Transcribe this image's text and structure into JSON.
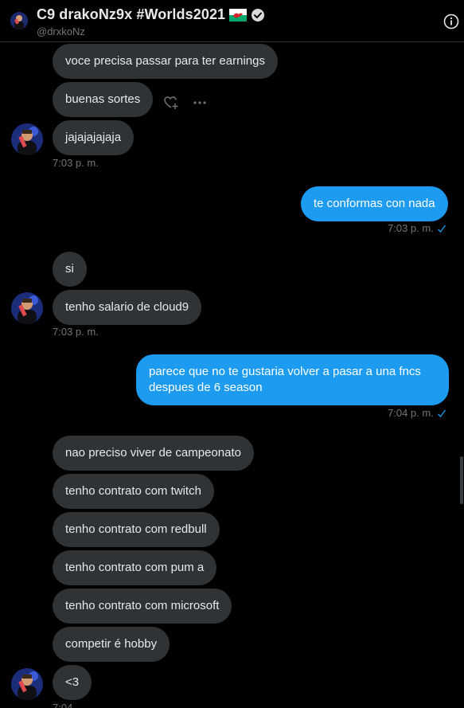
{
  "header": {
    "title": "C9 drakoNz9x #Worlds2021",
    "handle": "@drxkoNz",
    "info_label": "Conversation info"
  },
  "messages": [
    {
      "text": "voce precisa passar para ter earnings"
    },
    {
      "text": "buenas sortes"
    },
    {
      "text": "jajajajajaja"
    },
    {
      "text": "te conformas con nada"
    },
    {
      "text": "si"
    },
    {
      "text": "tenho salario de cloud9"
    },
    {
      "text": "parece que no te gustaria volver a pasar a una fncs despues de 6 season"
    },
    {
      "text": "nao preciso viver de campeonato"
    },
    {
      "text": "tenho contrato com twitch"
    },
    {
      "text": "tenho contrato com redbull"
    },
    {
      "text": "tenho contrato com pum a"
    },
    {
      "text": "tenho contrato com microsoft"
    },
    {
      "text": "competir é hobby"
    },
    {
      "text": "<3"
    }
  ],
  "timestamps": [
    {
      "text": "7:03 p. m."
    },
    {
      "text": "7:03 p. m."
    },
    {
      "text": "7:03 p. m."
    },
    {
      "text": "7:04 p. m."
    },
    {
      "text": "7:04"
    }
  ],
  "colors": {
    "background": "#000000",
    "incoming_bubble": "#2f3336",
    "outgoing_bubble": "#1d9bf0",
    "timestamp": "#71767b",
    "verified_badge": "#d9d9d9"
  }
}
